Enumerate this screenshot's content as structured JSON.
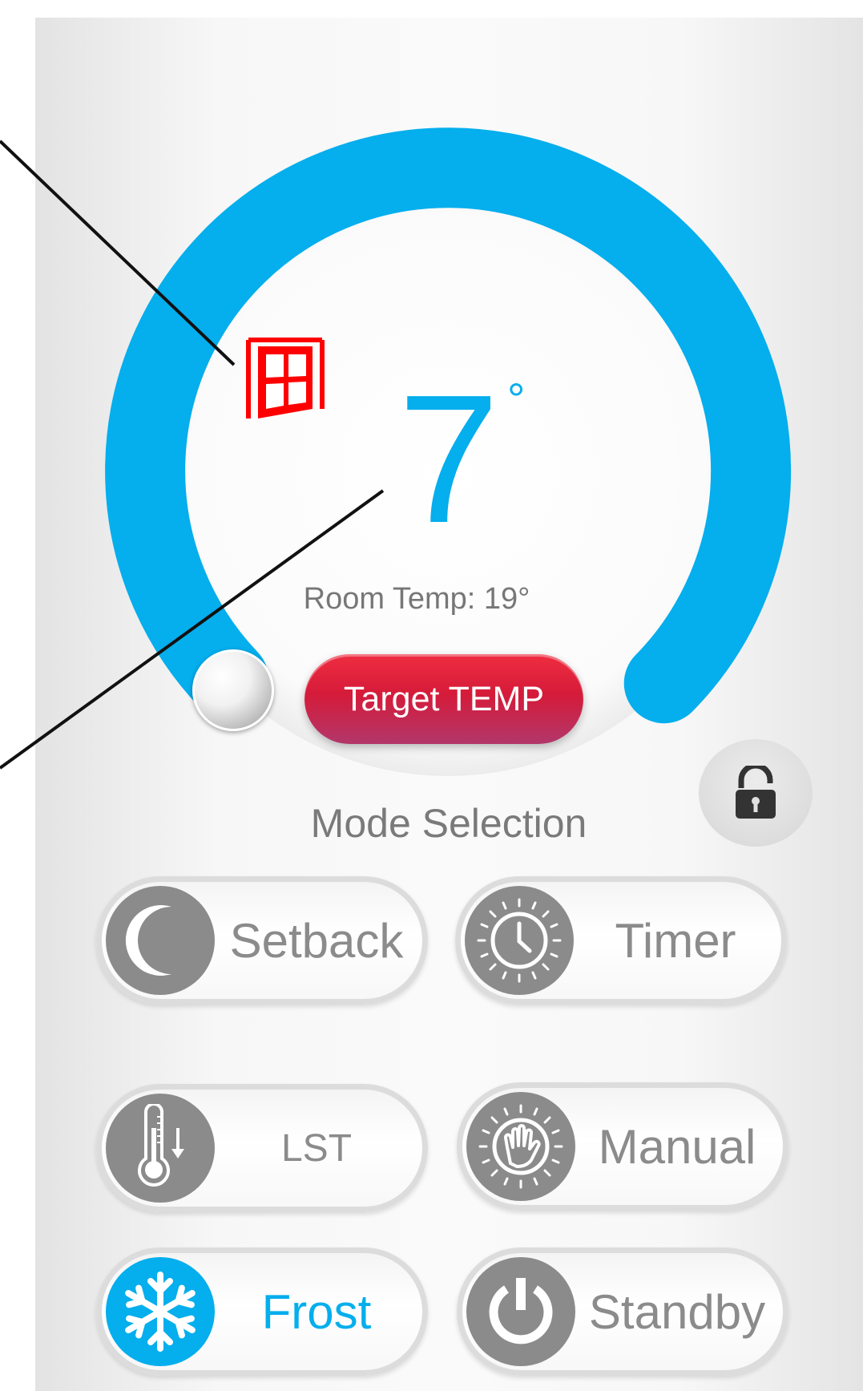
{
  "thermostat": {
    "target_temperature": "7",
    "degree_symbol": "°",
    "room_temp_text": "Room Temp: 19°",
    "target_button_label": "Target TEMP",
    "dial_color": "#05aeed",
    "window_open_indicator_icon": "open-window-icon",
    "lock_icon": "padlock-unlocked-icon"
  },
  "mode_selection": {
    "title": "Mode Selection",
    "modes": [
      {
        "label": "Setback",
        "icon": "moon-icon",
        "active": false
      },
      {
        "label": "Timer",
        "icon": "clock-icon",
        "active": false
      },
      {
        "label": "LST",
        "icon": "thermometer-down-icon",
        "active": false
      },
      {
        "label": "Manual",
        "icon": "hand-icon",
        "active": false
      },
      {
        "label": "Frost",
        "icon": "snowflake-icon",
        "active": true
      },
      {
        "label": "Standby",
        "icon": "power-icon",
        "active": false
      }
    ]
  },
  "colors": {
    "accent": "#05aeed",
    "target_button": "#d51b3a",
    "window_icon": "#ff0000",
    "inactive_gray": "#8b8b8b"
  }
}
